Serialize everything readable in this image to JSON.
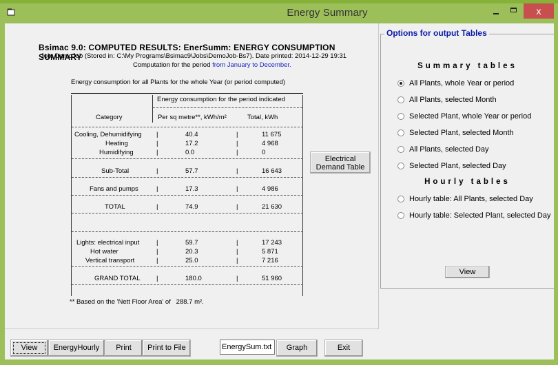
{
  "window": {
    "title": "Energy Summary",
    "close_glyph": "x",
    "icons": {
      "app": "app-window-icon",
      "minimize": "minimize-icon",
      "maximize": "maximize-icon",
      "close": "close-icon"
    }
  },
  "report": {
    "heading": "Bsimac 9.0: COMPUTED RESULTS: EnerSumm: ENERGY CONSUMPTION SUMMARY",
    "job_line": "Job: DemoJob (Stored in: C:\\My Programs\\Bsimac9\\Jobs\\DemoJob-Bs7). Date printed: 2014-12-29 19:31",
    "period_prefix": "Computation for the period ",
    "period_value": "from January to December.",
    "caption": "Energy consumption for all Plants for the whole Year (or period computed)",
    "table": {
      "group_header": "Energy consumption for the period indicated",
      "columns": [
        "Category",
        "Per sq metre**, kWh/m²",
        "Total, kWh"
      ],
      "rows": [
        {
          "category": "Cooling, Dehumidifying",
          "per_sqm": "40.4",
          "total": "11 675"
        },
        {
          "category": "Heating",
          "per_sqm": "17.2",
          "total": "4 968"
        },
        {
          "category": "Humidifying",
          "per_sqm": "0.0",
          "total": "0"
        },
        {
          "category": "Sub-Total",
          "per_sqm": "57.7",
          "total": "16 643"
        },
        {
          "category": "Fans and pumps",
          "per_sqm": "17.3",
          "total": "4 986"
        },
        {
          "category": "TOTAL",
          "per_sqm": "74.9",
          "total": "21 630"
        },
        {
          "category": "Lights: electrical input",
          "per_sqm": "59.7",
          "total": "17 243"
        },
        {
          "category": "Hot water",
          "per_sqm": "20.3",
          "total": "5 871"
        },
        {
          "category": "Vertical transport",
          "per_sqm": "25.0",
          "total": "7 216"
        },
        {
          "category": "GRAND TOTAL",
          "per_sqm": "180.0",
          "total": "51 960"
        }
      ]
    },
    "footnote": "** Based on the 'Nett Floor Area' of   288.7 m².",
    "electrical_button": [
      "Electrical",
      "Demand Table"
    ]
  },
  "options": {
    "legend": "Options for output Tables",
    "summary_heading": "Summary tables",
    "summary_options": [
      {
        "label": "All Plants, whole Year or period",
        "selected": true
      },
      {
        "label": "All Plants, selected Month",
        "selected": false
      },
      {
        "label": "Selected Plant, whole Year or period",
        "selected": false
      },
      {
        "label": "Selected Plant, selected Month",
        "selected": false
      },
      {
        "label": "All Plants, selected Day",
        "selected": false
      },
      {
        "label": "Selected Plant, selected Day",
        "selected": false
      }
    ],
    "hourly_heading": "Hourly tables",
    "hourly_options": [
      {
        "label": "Hourly table: All Plants, selected Day",
        "selected": false
      },
      {
        "label": "Hourly table: Selected Plant, selected Day",
        "selected": false
      }
    ],
    "view_label": "View"
  },
  "toolbar": {
    "view_label": "View",
    "energy_hourly_label": "EnergyHourly",
    "print_label": "Print",
    "print_to_file_label": "Print to File",
    "filename_value": "EnergySum.txt",
    "graph_label": "Graph",
    "exit_label": "Exit"
  }
}
